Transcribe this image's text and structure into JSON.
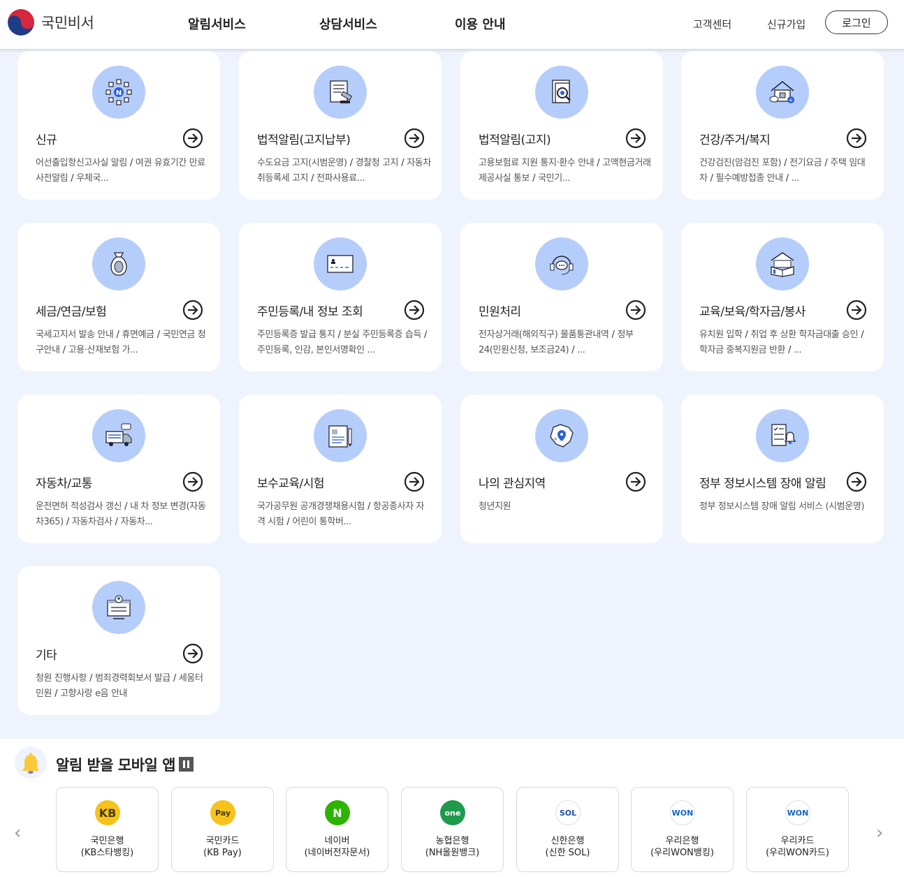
{
  "header": {
    "logo_text": "국민비서",
    "nav": [
      "알림서비스",
      "상담서비스",
      "이용 안내"
    ],
    "customer_center": "고객센터",
    "signup": "신규가입",
    "login": "로그인"
  },
  "cards": [
    {
      "title": "신규",
      "icon": "shield-n-icon",
      "desc": [
        "어선출입항신고사실 알림",
        "여권 유효기간 만료 사전알림",
        "우체국..."
      ]
    },
    {
      "title": "법적알림(고지납부)",
      "icon": "document-gavel-icon",
      "desc": [
        "수도요금 고지(시범운영)",
        "경찰청 고지",
        "자동차 취등록세 고지",
        "전파사용료..."
      ]
    },
    {
      "title": "법적알림(고지)",
      "icon": "document-search-icon",
      "desc": [
        "고용보험료 지원 통지·환수 안내",
        "고액현금거래 제공사실 통보",
        "국민기..."
      ]
    },
    {
      "title": "건강/주거/복지",
      "icon": "house-medical-icon",
      "desc": [
        "건강검진(암검진 포함)",
        "전기요금",
        "주택 임대차",
        "필수예방접종 안내",
        "..."
      ]
    },
    {
      "title": "세금/연금/보험",
      "icon": "money-bag-icon",
      "desc": [
        "국세고지서 발송 안내",
        "휴면예금",
        "국민연금 청구안내",
        "고용·산재보험 가..."
      ]
    },
    {
      "title": "주민등록/내 정보 조회",
      "icon": "id-card-icon",
      "desc": [
        "주민등록증 발급 통지",
        "분실 주민등록증 습득",
        "주민등록, 인감, 본인서명확인 ..."
      ]
    },
    {
      "title": "민원처리",
      "icon": "headset-icon",
      "desc": [
        "전자상거래(해외직구) 물품통관내역",
        "정부24(민원신청, 보조금24)",
        "..."
      ]
    },
    {
      "title": "교육/보육/학자금/봉사",
      "icon": "book-school-icon",
      "desc": [
        "유치원 입학",
        "취업 후 상환 학자금대출 승인",
        "학자금 중복지원금 반환",
        "..."
      ]
    },
    {
      "title": "자동차/교통",
      "icon": "truck-icon",
      "desc": [
        "운전면허 적성검사 갱신",
        "내 차 정보 변경(자동차365)",
        "자동차검사",
        "자동차..."
      ]
    },
    {
      "title": "보수교육/시험",
      "icon": "exam-pencil-icon",
      "desc": [
        "국가공무원 공개경쟁채용시험",
        "항공종사자 자격 시험",
        "어린이 통학버..."
      ]
    },
    {
      "title": "나의 관심지역",
      "icon": "map-region-icon",
      "desc": [
        "청년지원"
      ]
    },
    {
      "title": "정부 정보시스템 장애 알림",
      "icon": "checklist-bell-icon",
      "desc": [
        "정부 정보시스템 장애 알림 서비스 (시범운영)"
      ]
    },
    {
      "title": "기타",
      "icon": "monitor-person-icon",
      "desc": [
        "청원 진행사항",
        "범죄경력회보서 발급",
        "세움터 민원",
        "고향사랑 e음 안내"
      ]
    }
  ],
  "apps_section": {
    "title": "알림 받을 모바일 앱",
    "apps": [
      {
        "line1": "국민은행",
        "line2": "(KB스타뱅킹)",
        "logo": "KB",
        "color": "#f7c21b",
        "text_color": "#4a3c00"
      },
      {
        "line1": "국민카드",
        "line2": "(KB Pay)",
        "logo": "Pay",
        "color": "#f7c21b",
        "text_color": "#4a3c00"
      },
      {
        "line1": "네이버",
        "line2": "(네이버전자문서)",
        "logo": "N",
        "color": "#2db400",
        "text_color": "#ffffff"
      },
      {
        "line1": "농협은행",
        "line2": "(NH올원뱅크)",
        "logo": "one",
        "color": "#1e9a4b",
        "text_color": "#ffffff"
      },
      {
        "line1": "신한은행",
        "line2": "(신한 SOL)",
        "logo": "SOL",
        "color": "#ffffff",
        "text_color": "#1a4fa8"
      },
      {
        "line1": "우리은행",
        "line2": "(우리WON뱅킹)",
        "logo": "WON",
        "color": "#ffffff",
        "text_color": "#1066c9"
      },
      {
        "line1": "우리카드",
        "line2": "(우리WON카드)",
        "logo": "WON",
        "color": "#ffffff",
        "text_color": "#1066c9"
      }
    ]
  }
}
